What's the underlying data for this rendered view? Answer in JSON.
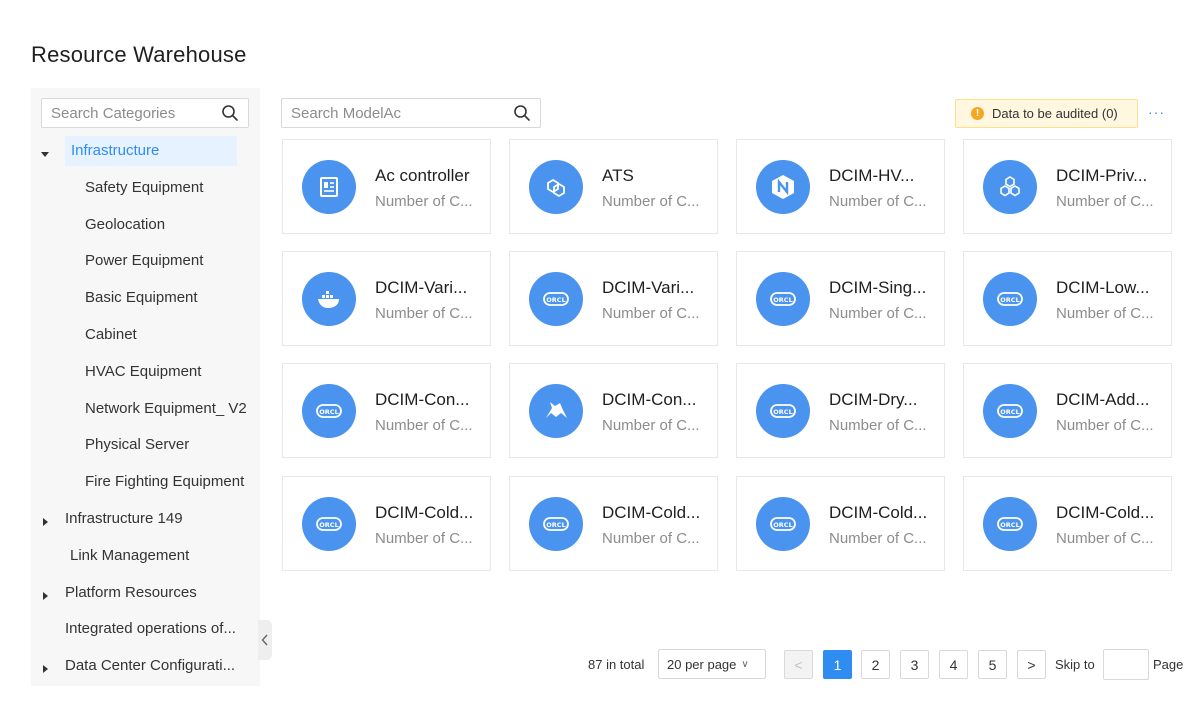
{
  "page": {
    "title": "Resource Warehouse"
  },
  "sidebar": {
    "search_placeholder": "Search Categories",
    "tree": [
      {
        "label": "Infrastructure",
        "level": 0,
        "expanded": true,
        "has_children": true,
        "selected": true
      },
      {
        "label": "Safety Equipment",
        "level": 1
      },
      {
        "label": "Geolocation",
        "level": 1
      },
      {
        "label": "Power Equipment",
        "level": 1
      },
      {
        "label": "Basic Equipment",
        "level": 1
      },
      {
        "label": "Cabinet",
        "level": 1
      },
      {
        "label": "HVAC Equipment",
        "level": 1
      },
      {
        "label": "Network Equipment_ V2",
        "level": 1
      },
      {
        "label": "Physical Server",
        "level": 1
      },
      {
        "label": "Fire Fighting Equipment",
        "level": 1
      },
      {
        "label": "Infrastructure 149",
        "level": 0,
        "expanded": false,
        "has_children": true
      },
      {
        "label": "Link Management",
        "level": 0,
        "has_children": false
      },
      {
        "label": "Platform Resources",
        "level": 0,
        "expanded": false,
        "has_children": true
      },
      {
        "label": "Integrated operations of...",
        "level": 0,
        "has_children": false
      },
      {
        "label": "Data Center Configurati...",
        "level": 0,
        "expanded": false,
        "has_children": true
      }
    ]
  },
  "main": {
    "search_placeholder": "Search ModelAc",
    "audit_badge": {
      "label": "Data to be audited (0)",
      "icon": "warning-icon",
      "color": "#f5a623"
    },
    "more_label": "···",
    "accent_color": "#2f8cf0",
    "icon_bg_color": "#4a93ee",
    "cards": [
      {
        "name": "Ac controller",
        "sub": "Number of C...",
        "icon": "controller-icon"
      },
      {
        "name": "ATS",
        "sub": "Number of C...",
        "icon": "ats-icon"
      },
      {
        "name": "DCIM-HV...",
        "sub": "Number of C...",
        "icon": "nginx-icon"
      },
      {
        "name": "DCIM-Priv...",
        "sub": "Number of C...",
        "icon": "hexagons-icon"
      },
      {
        "name": "DCIM-Vari...",
        "sub": "Number of C...",
        "icon": "docker-icon"
      },
      {
        "name": "DCIM-Vari...",
        "sub": "Number of C...",
        "icon": "oracle-icon"
      },
      {
        "name": "DCIM-Sing...",
        "sub": "Number of C...",
        "icon": "oracle-icon"
      },
      {
        "name": "DCIM-Low...",
        "sub": "Number of C...",
        "icon": "oracle-icon"
      },
      {
        "name": "DCIM-Con...",
        "sub": "Number of C...",
        "icon": "oracle-icon"
      },
      {
        "name": "DCIM-Con...",
        "sub": "Number of C...",
        "icon": "tomcat-icon"
      },
      {
        "name": "DCIM-Dry...",
        "sub": "Number of C...",
        "icon": "oracle-icon"
      },
      {
        "name": "DCIM-Add...",
        "sub": "Number of C...",
        "icon": "oracle-icon"
      },
      {
        "name": "DCIM-Cold...",
        "sub": "Number of C...",
        "icon": "oracle-icon"
      },
      {
        "name": "DCIM-Cold...",
        "sub": "Number of C...",
        "icon": "oracle-icon"
      },
      {
        "name": "DCIM-Cold...",
        "sub": "Number of C...",
        "icon": "oracle-icon"
      },
      {
        "name": "DCIM-Cold...",
        "sub": "Number of C...",
        "icon": "oracle-icon"
      }
    ]
  },
  "pagination": {
    "total_label": "87 in total",
    "per_page": "20 per page",
    "prev": "<",
    "next": ">",
    "pages": [
      "1",
      "2",
      "3",
      "4",
      "5"
    ],
    "current": "1",
    "skip_label": "Skip to",
    "skip_value": "",
    "page_label": "Page"
  }
}
